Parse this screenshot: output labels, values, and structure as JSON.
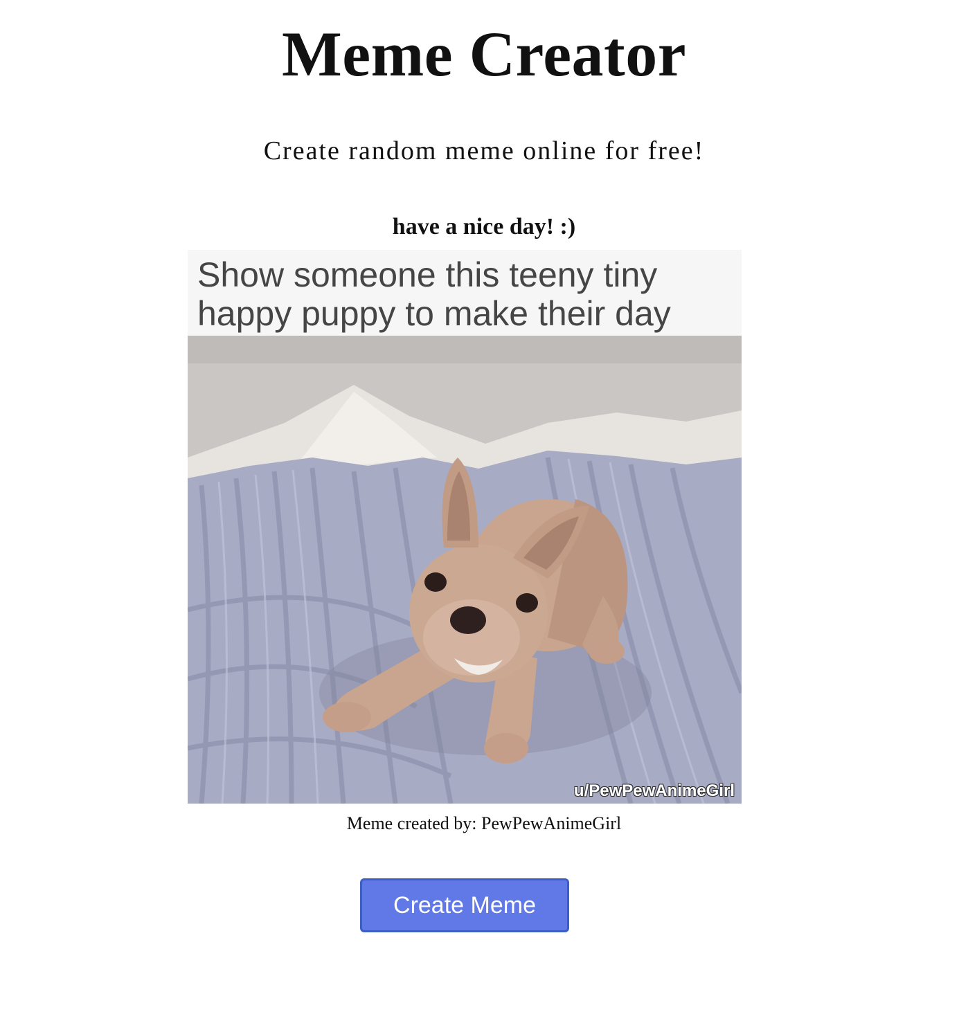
{
  "header": {
    "title": "Meme Creator",
    "subtitle": "Create random meme online for free!"
  },
  "meme": {
    "caption": "have a nice day! :)",
    "image_text": "Show someone this teeny tiny\nhappy puppy to make their day",
    "watermark": "u/PewPewAnimeGirl",
    "credit": "Meme created by: PewPewAnimeGirl"
  },
  "actions": {
    "create_label": "Create Meme"
  },
  "colors": {
    "button_bg": "#6079e7",
    "button_border": "#3b5fc6",
    "text": "#111111"
  }
}
